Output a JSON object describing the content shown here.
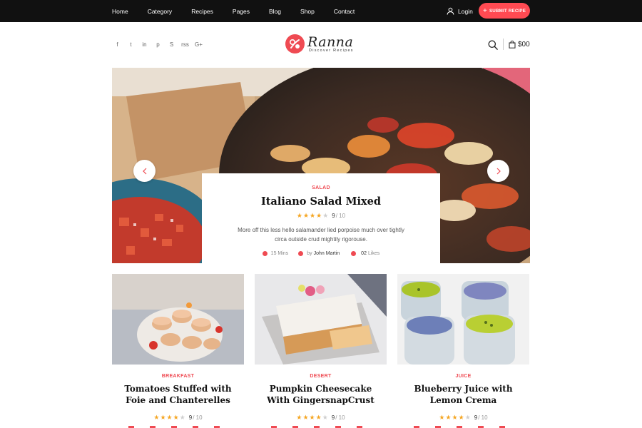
{
  "nav": {
    "items": [
      "Home",
      "Category",
      "Recipes",
      "Pages",
      "Blog",
      "Shop",
      "Contact"
    ],
    "login_label": "Login",
    "submit_label": "SUBMIT RECIPE"
  },
  "header": {
    "logo_name": "Ranna",
    "logo_tagline": "Discover Recipes",
    "social": [
      {
        "icon": "facebook-icon",
        "glyph": "f"
      },
      {
        "icon": "twitter-icon",
        "glyph": "t"
      },
      {
        "icon": "linkedin-icon",
        "glyph": "in"
      },
      {
        "icon": "pinterest-icon",
        "glyph": "p"
      },
      {
        "icon": "skype-icon",
        "glyph": "S"
      },
      {
        "icon": "rss-icon",
        "glyph": "rss"
      },
      {
        "icon": "google-plus-icon",
        "glyph": "G+"
      }
    ],
    "cart_total": "$00"
  },
  "hero": {
    "category": "SALAD",
    "title": "Italiano Salad Mixed",
    "rating": "9",
    "rating_max": "/ 10",
    "stars_filled": 4,
    "description": "More off this less hello salamander lied porpoise much over tightly circa outside crud mightily rigorouse.",
    "time": "15 Mins",
    "author_prefix": "by",
    "author": "John Martin",
    "likes": "02",
    "likes_label": "Likes"
  },
  "cards": [
    {
      "category": "BREAKFAST",
      "title": "Tomatoes Stuffed with Foie and Chanterelles",
      "rating": "9",
      "rating_max": "/ 10",
      "stars_filled": 4
    },
    {
      "category": "DESERT",
      "title": "Pumpkin Cheesecake With GingersnapCrust",
      "rating": "9",
      "rating_max": "/ 10",
      "stars_filled": 4
    },
    {
      "category": "JUICE",
      "title": "Blueberry Juice with Lemon Crema",
      "rating": "9",
      "rating_max": "/ 10",
      "stars_filled": 4
    }
  ],
  "colors": {
    "accent": "#ef4a52",
    "topbar": "#111111",
    "star": "#f5a623"
  }
}
